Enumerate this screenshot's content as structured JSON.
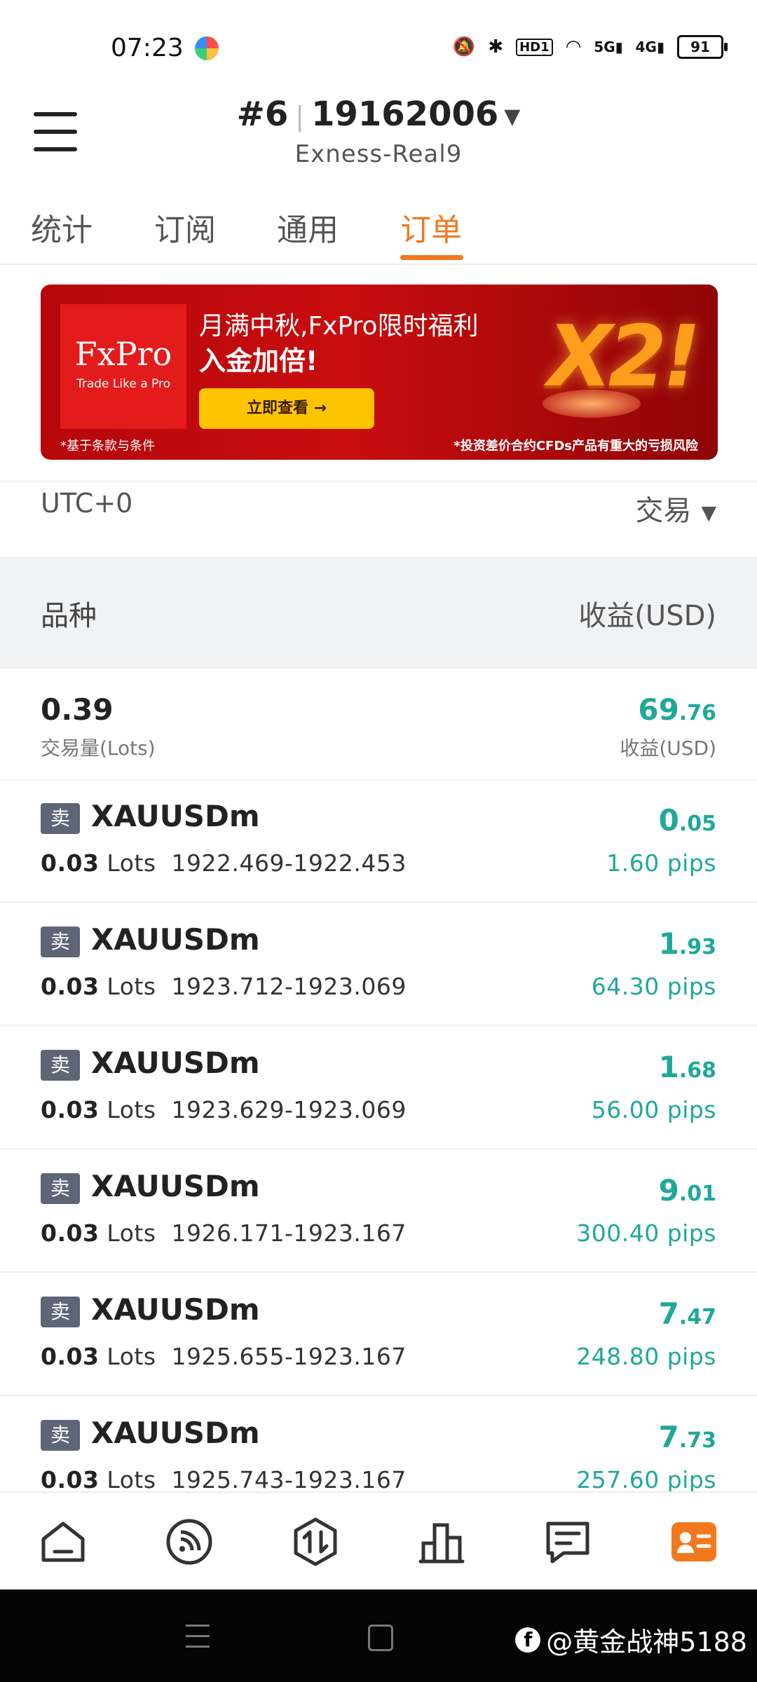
{
  "status_bar": {
    "time": "07:23",
    "battery": "91",
    "network_5g": "5G",
    "network_4g": "4G",
    "hd": "HD1"
  },
  "header": {
    "account_number": "#6",
    "account_id": "19162006",
    "server": "Exness-Real9"
  },
  "tabs": [
    {
      "label": "统计"
    },
    {
      "label": "订阅"
    },
    {
      "label": "通用"
    },
    {
      "label": "订单",
      "active": true
    }
  ],
  "banner": {
    "logo": "FxPro",
    "logo_tagline": "Trade Like a Pro",
    "line1": "月满中秋,FxPro限时福利",
    "line2": "入金加倍!",
    "button": "立即查看 →",
    "big_text": "X2!",
    "note_left": "*基于条款与条件",
    "note_right": "*投资差价合约CFDs产品有重大的亏损风险"
  },
  "filter": {
    "timezone": "UTC+0",
    "type": "交易"
  },
  "table_header": {
    "left": "品种",
    "right": "收益(USD)"
  },
  "summary": {
    "volume": "0.39",
    "volume_label": "交易量(Lots)",
    "profit_int": "69",
    "profit_dec": ".76",
    "profit_label": "收益(USD)"
  },
  "orders": [
    {
      "side": "卖",
      "symbol": "XAUUSDm",
      "lots": "0.03",
      "lots_unit": "Lots",
      "prices": "1922.469-1922.453",
      "profit_int": "0",
      "profit_dec": ".05",
      "pips": "1.60 pips"
    },
    {
      "side": "卖",
      "symbol": "XAUUSDm",
      "lots": "0.03",
      "lots_unit": "Lots",
      "prices": "1923.712-1923.069",
      "profit_int": "1",
      "profit_dec": ".93",
      "pips": "64.30 pips"
    },
    {
      "side": "卖",
      "symbol": "XAUUSDm",
      "lots": "0.03",
      "lots_unit": "Lots",
      "prices": "1923.629-1923.069",
      "profit_int": "1",
      "profit_dec": ".68",
      "pips": "56.00 pips"
    },
    {
      "side": "卖",
      "symbol": "XAUUSDm",
      "lots": "0.03",
      "lots_unit": "Lots",
      "prices": "1926.171-1923.167",
      "profit_int": "9",
      "profit_dec": ".01",
      "pips": "300.40 pips"
    },
    {
      "side": "卖",
      "symbol": "XAUUSDm",
      "lots": "0.03",
      "lots_unit": "Lots",
      "prices": "1925.655-1923.167",
      "profit_int": "7",
      "profit_dec": ".47",
      "pips": "248.80 pips"
    },
    {
      "side": "卖",
      "symbol": "XAUUSDm",
      "lots": "0.03",
      "lots_unit": "Lots",
      "prices": "1925.743-1923.167",
      "profit_int": "7",
      "profit_dec": ".73",
      "pips": "257.60 pips"
    }
  ],
  "bottom_nav": [
    {
      "icon": "home-icon"
    },
    {
      "icon": "signal-icon"
    },
    {
      "icon": "trade-icon"
    },
    {
      "icon": "chart-icon"
    },
    {
      "icon": "message-icon"
    },
    {
      "icon": "profile-card-icon",
      "active": true
    }
  ],
  "colors": {
    "accent": "#f2781d",
    "profit": "#1fa89a",
    "badge": "#5d6576"
  },
  "watermark": "@黄金战神5188"
}
